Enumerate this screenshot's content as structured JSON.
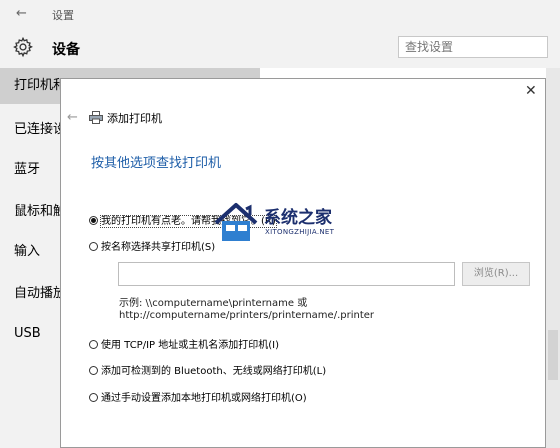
{
  "settings_window": {
    "title": "设置",
    "header_title": "设备",
    "search_placeholder": "查找设置",
    "sidebar_items": [
      {
        "label": "打印机和"
      },
      {
        "label": "已连接设"
      },
      {
        "label": "蓝牙"
      },
      {
        "label": "鼠标和触"
      },
      {
        "label": "输入"
      },
      {
        "label": "自动播放"
      },
      {
        "label": "USB"
      }
    ]
  },
  "dialog": {
    "title": "添加打印机",
    "heading": "按其他选项查找打印机",
    "options": [
      {
        "label": "我的打印机有点老。请帮我找到它。(R)",
        "checked": true
      },
      {
        "label": "按名称选择共享打印机(S)",
        "checked": false
      },
      {
        "label": "使用 TCP/IP 地址或主机名添加打印机(I)",
        "checked": false
      },
      {
        "label": "添加可检测到的 Bluetooth、无线或网络打印机(L)",
        "checked": false
      },
      {
        "label": "通过手动设置添加本地打印机或网络打印机(O)",
        "checked": false
      }
    ],
    "share_input_value": "",
    "browse_label": "浏览(R)...",
    "example_line1": "示例: \\\\computername\\printername 或",
    "example_line2": "http://computername/printers/printername/.printer"
  },
  "watermark": {
    "text": "系统之家",
    "subtext": "XITONGZHIJIA.NET"
  },
  "icons": {
    "back": "arrow-left-icon",
    "gear": "gear-icon",
    "close": "close-icon",
    "printer": "printer-icon"
  },
  "colors": {
    "heading_blue": "#1e5ea8",
    "sidebar_bg": "#f2f2f2",
    "selected_item": "#cfcfcf"
  }
}
